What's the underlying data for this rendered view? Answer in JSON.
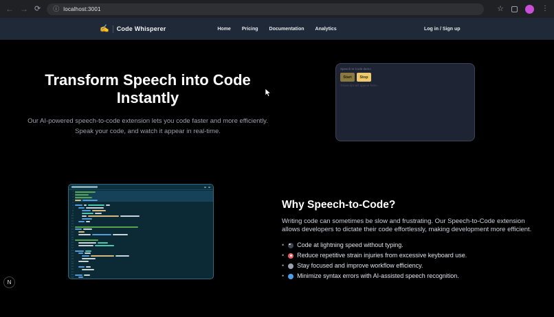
{
  "browser": {
    "url": "localhost:3001",
    "back_icon": "←",
    "forward_icon": "→",
    "reload_icon": "⟳",
    "info_icon": "ⓘ",
    "star_icon": "☆",
    "kebab_icon": "⋮",
    "avatar_color": "#c94fd6"
  },
  "navbar": {
    "brand": "Code Whisperer",
    "brand_icon": "✍",
    "links": [
      "Home",
      "Pricing",
      "Documentation",
      "Analytics"
    ],
    "auth": "Log in / Sign up",
    "bg_color": "#1f2937"
  },
  "hero": {
    "title": "Transform Speech into Code Instantly",
    "subtitle": "Our AI-powered speech-to-code extension lets you code faster and more efficiently. Speak your code, and watch it appear in real-time.",
    "demo": {
      "label": "Speech to Code demo",
      "start_label": "Start",
      "stop_label": "Stop",
      "hint": "Transcript will appear here...",
      "start_color": "#8a7a41",
      "stop_color": "#efc96d"
    }
  },
  "why": {
    "heading": "Why Speech-to-Code?",
    "paragraph": "Writing code can sometimes be slow and frustrating. Our Speech-to-Code extension allows developers to dictate their code effortlessly, making development more efficient.",
    "bullets": [
      {
        "icon": "lightning-icon",
        "color": "#3f4750",
        "glint": true,
        "text": "Code at lightning speed without typing."
      },
      {
        "icon": "target-icon",
        "color": "#e85d5d",
        "center": true,
        "text": "Reduce repetitive strain injuries from excessive keyboard use."
      },
      {
        "icon": "tools-icon",
        "color": "#9aa3ad",
        "glint": false,
        "text": "Stay focused and improve workflow efficiency."
      },
      {
        "icon": "magnifier-icon",
        "color": "#4b9fe8",
        "glint": false,
        "text": "Minimize syntax errors with AI-assisted speech recognition."
      }
    ]
  },
  "editor": {
    "colors": {
      "green": "#57a64a",
      "blue": "#569cd6",
      "cyan": "#4ec9b0",
      "yellow": "#d7ba7d",
      "white": "#c9d6da"
    },
    "background": "#0b2a36",
    "lines": [
      {
        "hl": true,
        "ind": 0,
        "segs": [
          [
            "green",
            30
          ]
        ]
      },
      {
        "hl": true,
        "ind": 0,
        "segs": [
          [
            "green",
            20
          ]
        ]
      },
      {
        "hl": true,
        "ind": 0,
        "segs": [
          [
            "green",
            25
          ]
        ]
      },
      {
        "hl": true,
        "ind": 0,
        "segs": [
          [
            "yellow",
            9
          ],
          [
            "blue",
            22
          ]
        ]
      },
      {
        "hl": false,
        "ind": 0,
        "segs": []
      },
      {
        "hl": false,
        "ind": 0,
        "segs": [
          [
            "blue",
            11
          ],
          [
            "white",
            4
          ],
          [
            "cyan",
            24
          ],
          [
            "white",
            6
          ]
        ]
      },
      {
        "hl": false,
        "ind": 1,
        "segs": [
          [
            "blue",
            9
          ],
          [
            "white",
            26
          ]
        ]
      },
      {
        "hl": false,
        "ind": 2,
        "segs": [
          [
            "blue",
            13
          ],
          [
            "yellow",
            20
          ]
        ]
      },
      {
        "hl": false,
        "ind": 2,
        "segs": [
          [
            "cyan",
            17
          ],
          [
            "white",
            10
          ]
        ]
      },
      {
        "hl": false,
        "ind": 2,
        "segs": [
          [
            "white",
            7
          ],
          [
            "yellow",
            45
          ],
          [
            "white",
            28
          ]
        ]
      },
      {
        "hl": false,
        "ind": 2,
        "segs": [
          [
            "blue",
            15
          ]
        ]
      },
      {
        "hl": false,
        "ind": 1,
        "segs": [
          [
            "blue",
            9
          ],
          [
            "white",
            6
          ]
        ]
      },
      {
        "hl": false,
        "ind": 0,
        "segs": []
      },
      {
        "hl": false,
        "ind": 0,
        "segs": [
          [
            "green",
            92
          ]
        ]
      },
      {
        "hl": false,
        "ind": 0,
        "segs": [
          [
            "blue",
            10
          ],
          [
            "white",
            13
          ]
        ]
      },
      {
        "hl": false,
        "ind": 1,
        "segs": [
          [
            "yellow",
            9
          ]
        ]
      },
      {
        "hl": false,
        "ind": 1,
        "segs": [
          [
            "white",
            18
          ],
          [
            "blue",
            28
          ],
          [
            "white",
            22
          ]
        ]
      },
      {
        "hl": false,
        "ind": 0,
        "segs": []
      },
      {
        "hl": false,
        "ind": 0,
        "segs": [
          [
            "green",
            34
          ]
        ]
      },
      {
        "hl": false,
        "ind": 1,
        "segs": [
          [
            "white",
            26
          ],
          [
            "cyan",
            15
          ]
        ]
      },
      {
        "hl": false,
        "ind": 1,
        "segs": [
          [
            "white",
            22
          ],
          [
            "cyan",
            28
          ]
        ]
      },
      {
        "hl": false,
        "ind": 0,
        "segs": []
      },
      {
        "hl": false,
        "ind": 0,
        "segs": [
          [
            "blue",
            13
          ],
          [
            "cyan",
            9
          ]
        ]
      },
      {
        "hl": false,
        "ind": 1,
        "segs": [
          [
            "blue",
            7
          ],
          [
            "white",
            9
          ]
        ]
      },
      {
        "hl": false,
        "ind": 2,
        "segs": [
          [
            "blue",
            11
          ],
          [
            "yellow",
            34
          ],
          [
            "white",
            20
          ]
        ]
      },
      {
        "hl": false,
        "ind": 2,
        "segs": [
          [
            "white",
            20
          ]
        ]
      },
      {
        "hl": false,
        "ind": 1,
        "segs": [
          [
            "white",
            15
          ]
        ]
      },
      {
        "hl": false,
        "ind": 0,
        "segs": []
      },
      {
        "hl": false,
        "ind": 1,
        "segs": [
          [
            "blue",
            9
          ],
          [
            "white",
            7
          ]
        ]
      },
      {
        "hl": false,
        "ind": 2,
        "segs": [
          [
            "white",
            18
          ]
        ]
      },
      {
        "hl": false,
        "ind": 0,
        "segs": []
      },
      {
        "hl": false,
        "ind": 0,
        "segs": [
          [
            "blue",
            11
          ],
          [
            "white",
            9
          ]
        ]
      },
      {
        "hl": false,
        "ind": 1,
        "segs": [
          [
            "blue",
            7
          ]
        ]
      },
      {
        "hl": false,
        "ind": 2,
        "segs": [
          [
            "white",
            13
          ]
        ]
      }
    ]
  },
  "dev_badge": "N"
}
